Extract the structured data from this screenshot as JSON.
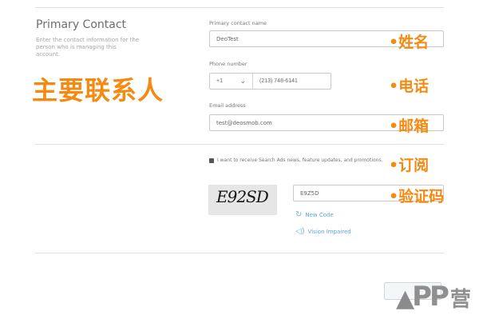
{
  "section": {
    "title": "Primary Contact",
    "description": "Enter the contact information for the person who is managing this account."
  },
  "annotations": {
    "main": "主要联系人",
    "name": "•姓名",
    "phone": "•电话",
    "email": "•邮箱",
    "subscribe": "•订阅",
    "captcha": "•验证码"
  },
  "form": {
    "name_label": "Primary contact name",
    "name_value": "DeoTest",
    "phone_label": "Phone number",
    "country_code": "+1",
    "phone_value": "(213) 748-6141",
    "email_label": "Email address",
    "email_value": "test@deosmob.com",
    "checkbox_label": "I want to receive Search Ads news, feature updates, and promotions.",
    "checkbox_checked": true,
    "captcha_image_text": "E92SD",
    "captcha_value": "E9Z5D",
    "new_code_label": "New Code",
    "vision_impaired_label": "Vision Impaired"
  },
  "watermark": {
    "logo_text": "PP",
    "logo_cn": "营"
  },
  "colors": {
    "annotation": "#f58a12",
    "link": "#58a8d9",
    "border": "#c9c9c9"
  }
}
